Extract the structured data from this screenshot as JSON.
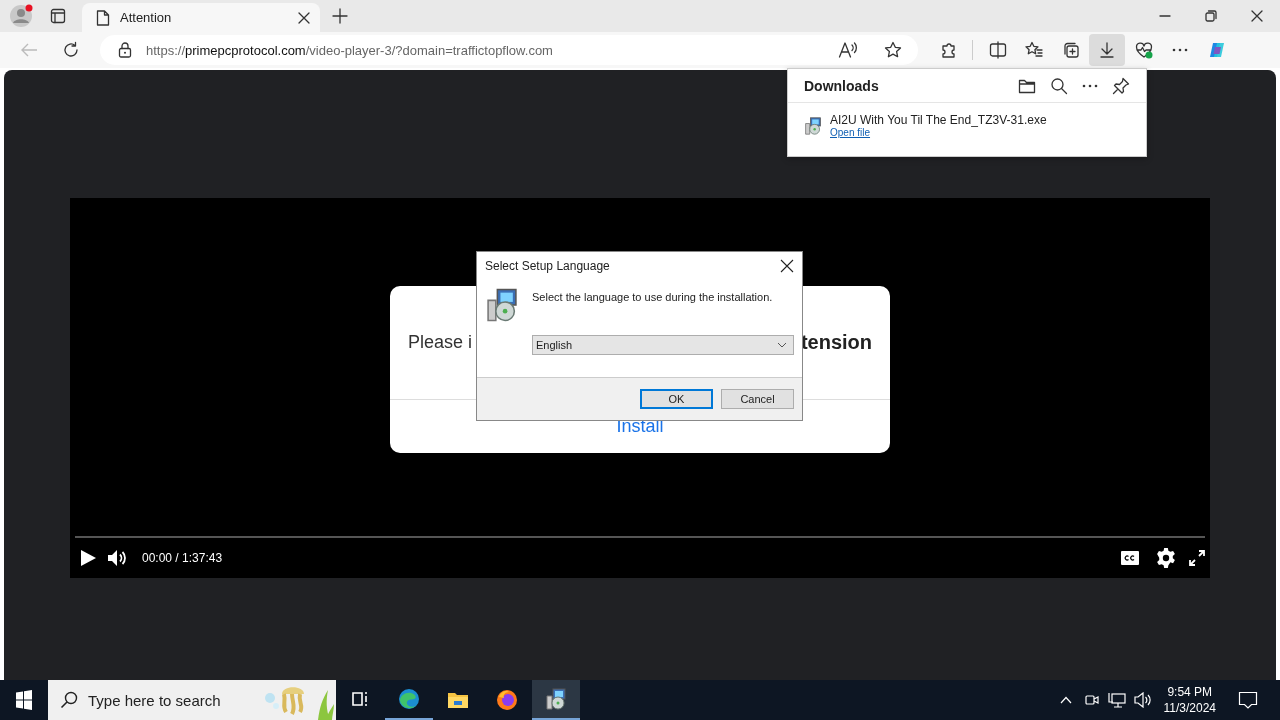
{
  "browser": {
    "tabs": [
      {
        "title": "Attention",
        "selected": true
      }
    ],
    "address": {
      "scheme": "https://",
      "host": "primepcprotocol.com",
      "path": "/video-player-3/?domain=traffictopflow.com"
    },
    "toolbar_buttons": [
      {
        "kind": "extensions",
        "selected": false
      },
      {
        "kind": "split",
        "selected": false
      },
      {
        "kind": "favorites",
        "selected": false
      },
      {
        "kind": "collections",
        "selected": false
      },
      {
        "kind": "downloads",
        "selected": true
      },
      {
        "kind": "essentials",
        "selected": false
      },
      {
        "kind": "more",
        "selected": false
      },
      {
        "kind": "copilot",
        "selected": false
      }
    ]
  },
  "downloads": {
    "title": "Downloads",
    "items": [
      {
        "file_name": "AI2U With You Til The End_TZ3V-31.exe",
        "action": "Open file"
      }
    ]
  },
  "video": {
    "overlay": {
      "text_start": "Please i",
      "text_end": "tension",
      "button": "Install"
    },
    "time": "00:00 / 1:37:43"
  },
  "dialog": {
    "title": "Select Setup Language",
    "message": "Select the language to use during the installation.",
    "language": "English",
    "buttons": [
      {
        "label": "OK",
        "default": true
      },
      {
        "label": "Cancel",
        "default": false
      }
    ]
  },
  "taskbar": {
    "search": {
      "placeholder": "Type here to search"
    },
    "apps": [
      {
        "kind": "task-view",
        "running": false,
        "selected": false
      },
      {
        "kind": "edge",
        "running": true,
        "selected": false
      },
      {
        "kind": "explorer",
        "running": false,
        "selected": false
      },
      {
        "kind": "firefox",
        "running": false,
        "selected": false
      },
      {
        "kind": "setup",
        "running": true,
        "selected": true
      }
    ],
    "clock": {
      "time": "9:54 PM",
      "date": "11/3/2024"
    }
  }
}
